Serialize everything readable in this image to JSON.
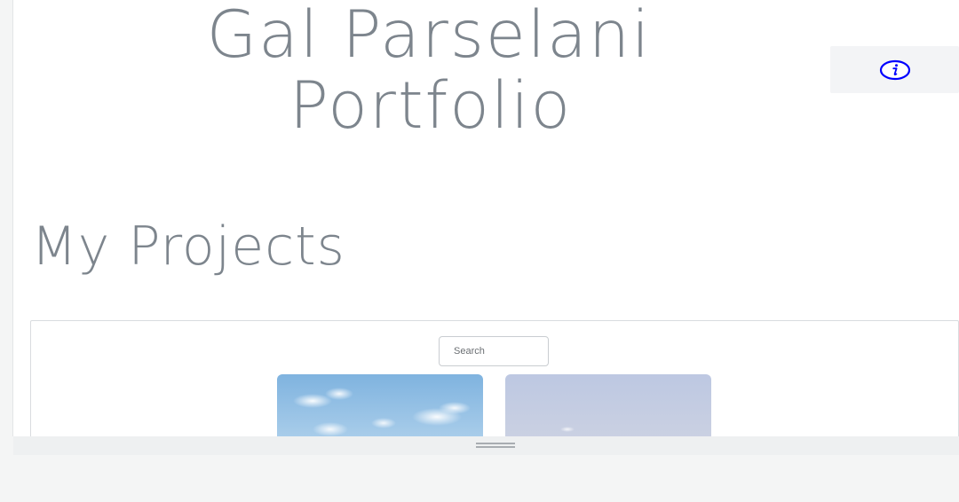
{
  "header": {
    "title_line1": "Gal Parselani",
    "title_line2": "Portfolio"
  },
  "info_button": {
    "icon": "info-icon",
    "color": "#0000ff"
  },
  "projects": {
    "title": "My Projects",
    "search": {
      "placeholder": "Search",
      "value": ""
    },
    "cards": [
      {
        "thumbnail": "sky-clouds-image"
      },
      {
        "thumbnail": "pale-sky-image"
      }
    ]
  },
  "bottom_bar": {
    "handle_icon": "drag-handle-icon"
  }
}
